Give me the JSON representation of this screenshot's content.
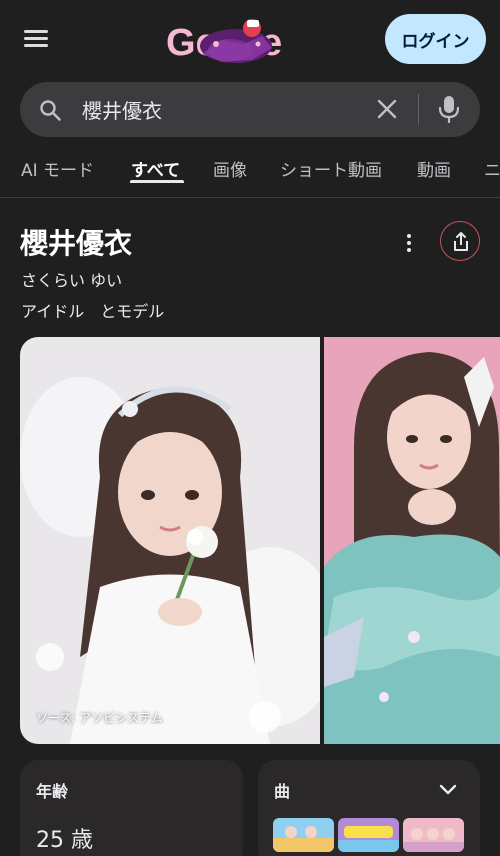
{
  "header": {
    "logo_text": "Ge gle",
    "login_label": "ログイン"
  },
  "search": {
    "query": "櫻井優衣",
    "placeholder": ""
  },
  "tabs": [
    {
      "label": "AI モード"
    },
    {
      "label": "すべて",
      "active": true
    },
    {
      "label": "画像"
    },
    {
      "label": "ショート動画"
    },
    {
      "label": "動画"
    },
    {
      "label": "ニ"
    }
  ],
  "knowledge_panel": {
    "title": "櫻井優衣",
    "reading": "さくらい ゆい",
    "description": "アイドル　とモデル",
    "photo_source": "ソース: アソビシステム"
  },
  "cards": {
    "age_label": "年齢",
    "age_value": "25 歳",
    "songs_label": "曲"
  },
  "icons": [
    "menu-icon",
    "search-icon",
    "close-icon",
    "mic-icon",
    "more-vert-icon",
    "share-icon",
    "chevron-down-icon"
  ],
  "colors": {
    "background": "#1f1f1f",
    "login_button": "#c2e7ff",
    "search_bar": "#3c3c3e",
    "share_ring": "#c5535e"
  }
}
